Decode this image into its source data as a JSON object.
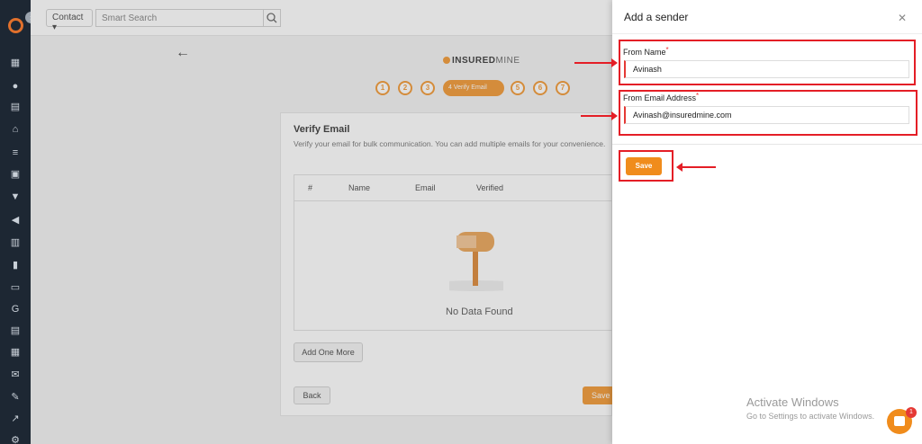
{
  "topbar": {
    "contact_select": "Contact",
    "search_placeholder": "Smart Search"
  },
  "brand": {
    "bold": "INSURED",
    "light": "MINE"
  },
  "steps": [
    "1",
    "2",
    "3",
    "4",
    "5",
    "6",
    "7"
  ],
  "active_step_label": "Verify Email",
  "card": {
    "title": "Verify Email",
    "subtitle": "Verify your email for bulk communication. You can add multiple emails for your convenience.",
    "columns": [
      "#",
      "Name",
      "Email",
      "Verified"
    ],
    "empty_text": "No Data Found",
    "add_button": "Add One More",
    "back_button": "Back",
    "save_button": "Save"
  },
  "drawer": {
    "title": "Add a sender",
    "from_name_label": "From Name",
    "from_name_value": "Avinash",
    "from_email_label": "From Email Address",
    "from_email_value": "Avinash@insuredmine.com",
    "save_label": "Save",
    "required_mark": "*"
  },
  "watermark": {
    "title": "Activate Windows",
    "subtitle": "Go to Settings to activate Windows."
  },
  "chat_badge": "1",
  "colors": {
    "accent": "#f08c1c",
    "annotation": "#e41e26",
    "sidebar": "#1d2733"
  }
}
